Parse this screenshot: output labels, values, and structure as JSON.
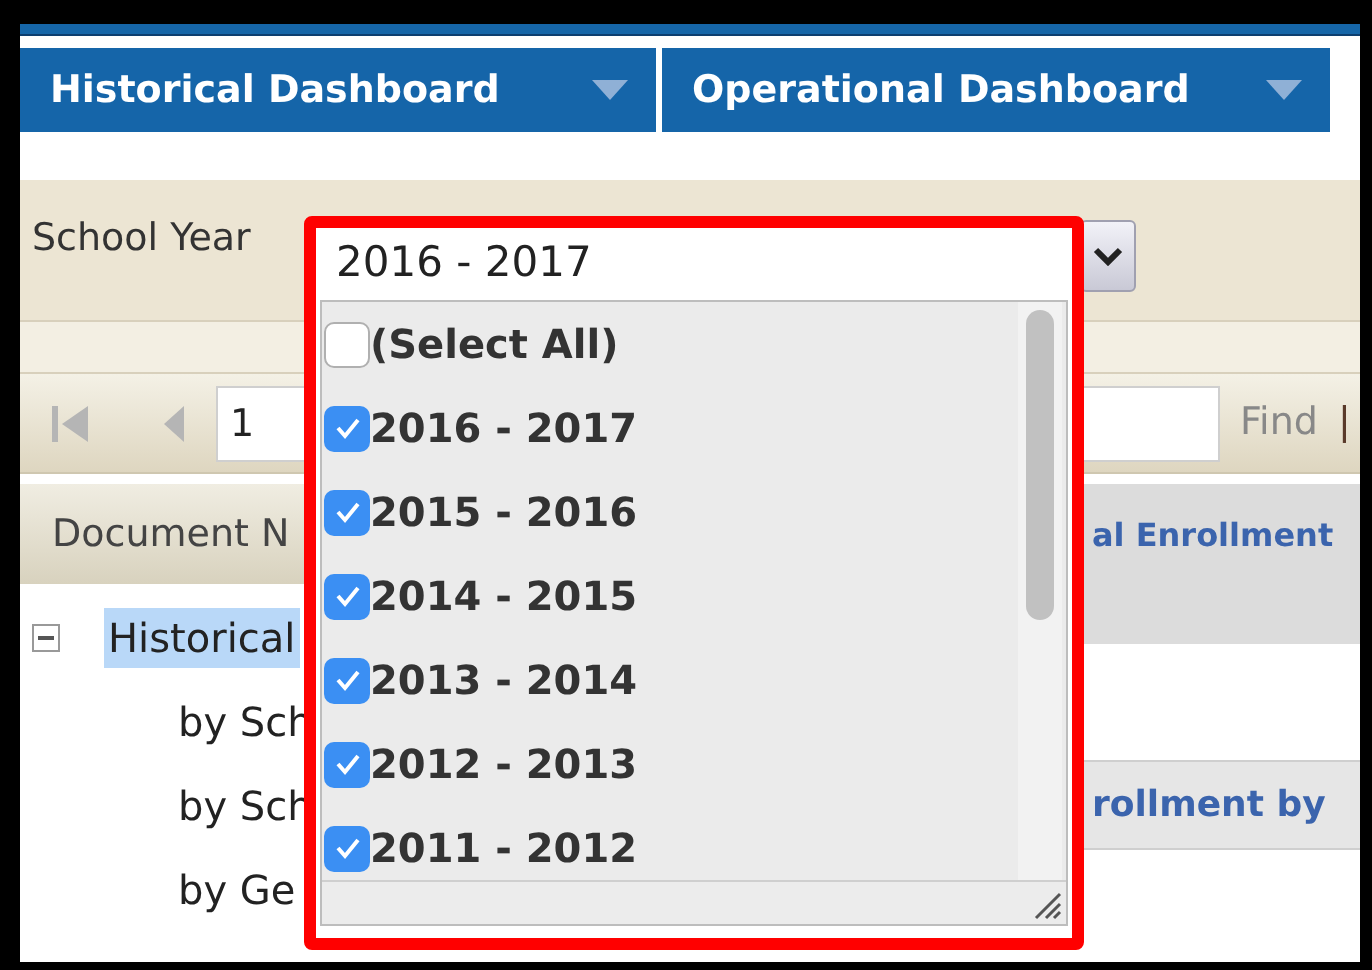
{
  "tabs": [
    {
      "label": "Historical Dashboard"
    },
    {
      "label": "Operational Dashboard"
    }
  ],
  "filter": {
    "label": "School Year",
    "value": "2016 - 2017"
  },
  "dropdown": {
    "options": [
      {
        "label": "(Select All)",
        "checked": false
      },
      {
        "label": "2016 - 2017",
        "checked": true
      },
      {
        "label": "2015 - 2016",
        "checked": true
      },
      {
        "label": "2014 - 2015",
        "checked": true
      },
      {
        "label": "2013 - 2014",
        "checked": true
      },
      {
        "label": "2012 - 2013",
        "checked": true
      },
      {
        "label": "2011 - 2012",
        "checked": true
      }
    ]
  },
  "pager": {
    "page": "1",
    "find": "Find",
    "separator": "|"
  },
  "table": {
    "column_1": "Document N",
    "column_2": "al Enrollment",
    "section": "rollment by"
  },
  "tree": {
    "label": "Historical",
    "expanded": true,
    "selected": true,
    "children": [
      {
        "label": "by Sch"
      },
      {
        "label": "by Sch"
      },
      {
        "label": "by Ge"
      }
    ]
  }
}
